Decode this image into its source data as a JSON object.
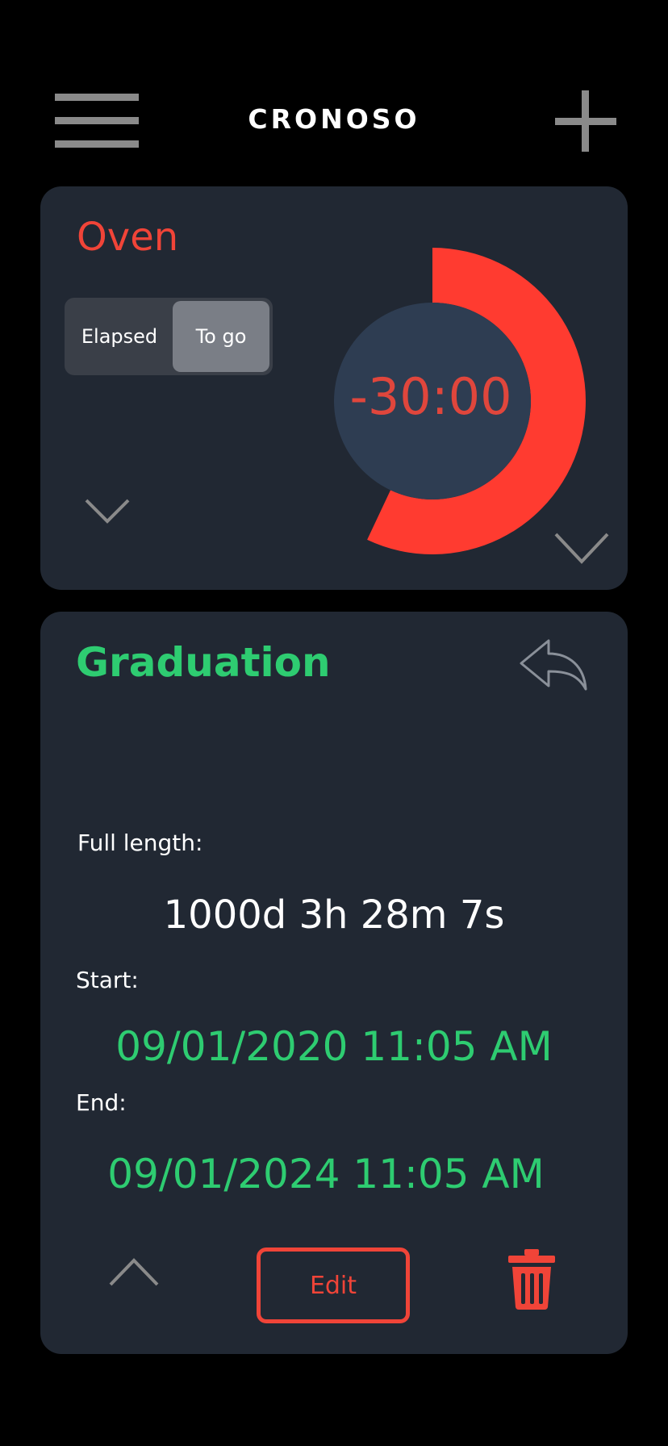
{
  "header": {
    "title": "CRONOSO",
    "menu_icon": "hamburger-menu-icon",
    "add_icon": "plus-icon"
  },
  "timers": [
    {
      "title": "Oven",
      "title_color": "#f04438",
      "mode_toggle": {
        "options": [
          "Elapsed",
          "To go"
        ],
        "selected": "To go"
      },
      "countdown": "-30:00",
      "progress_fraction": 0.57,
      "progress_color": "#ff3b30",
      "icons": [
        "chevron-down-icon",
        "chevron-down-icon"
      ]
    },
    {
      "title": "Graduation",
      "title_color": "#2ecc71",
      "share_icon": "reply-arrow-icon",
      "full_length_label": "Full length:",
      "full_length_value": "1000d 3h 28m 7s",
      "start_label": "Start:",
      "start_value": "09/01/2020 11:05 AM",
      "end_label": "End:",
      "end_value": "09/01/2024 11:05 AM",
      "edit_label": "Edit",
      "collapse_icon": "chevron-up-icon",
      "delete_icon": "trash-icon",
      "accent_red": "#f04438"
    }
  ]
}
